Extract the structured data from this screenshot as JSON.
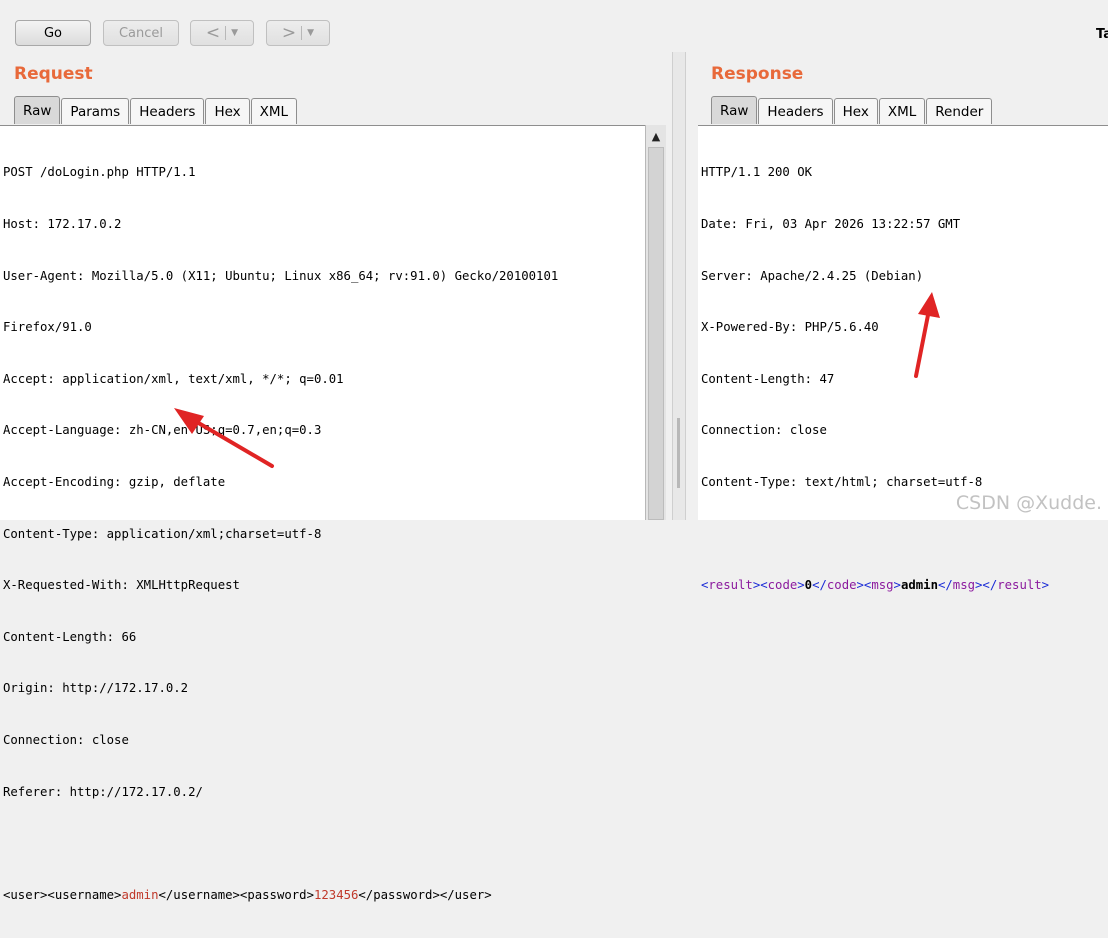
{
  "toolbar": {
    "go": "Go",
    "cancel": "Cancel",
    "back": "<",
    "forward": ">",
    "dropdown": "▼",
    "cut_label": "Ta"
  },
  "request": {
    "title": "Request",
    "tabs": [
      "Raw",
      "Params",
      "Headers",
      "Hex",
      "XML"
    ],
    "active_tab": "Raw",
    "lines": [
      "POST /doLogin.php HTTP/1.1",
      "Host: 172.17.0.2",
      "User-Agent: Mozilla/5.0 (X11; Ubuntu; Linux x86_64; rv:91.0) Gecko/20100101",
      "Firefox/91.0",
      "Accept: application/xml, text/xml, */*; q=0.01",
      "Accept-Language: zh-CN,en-US;q=0.7,en;q=0.3",
      "Accept-Encoding: gzip, deflate",
      "Content-Type: application/xml;charset=utf-8",
      "X-Requested-With: XMLHttpRequest",
      "Content-Length: 66",
      "Origin: http://172.17.0.2",
      "Connection: close",
      "Referer: http://172.17.0.2/"
    ],
    "body": {
      "p1": "<user><username>",
      "username": "admin",
      "p2": "</username><password>",
      "password": "123456",
      "p3": "</password></user>"
    }
  },
  "response": {
    "title": "Response",
    "tabs": [
      "Raw",
      "Headers",
      "Hex",
      "XML",
      "Render"
    ],
    "active_tab": "Raw",
    "lines": [
      "HTTP/1.1 200 OK",
      "Date: Fri, 03 Apr 2026 13:22:57 GMT",
      "Server: Apache/2.4.25 (Debian)",
      "X-Powered-By: PHP/5.6.40",
      "Content-Length: 47",
      "Connection: close",
      "Content-Type: text/html; charset=utf-8"
    ],
    "body": {
      "lt": "<",
      "gt": ">",
      "lts": "</",
      "result": "result",
      "code": "code",
      "msg": "msg",
      "code_value": "0",
      "msg_value": "admin"
    }
  },
  "watermark": "CSDN @Xudde."
}
